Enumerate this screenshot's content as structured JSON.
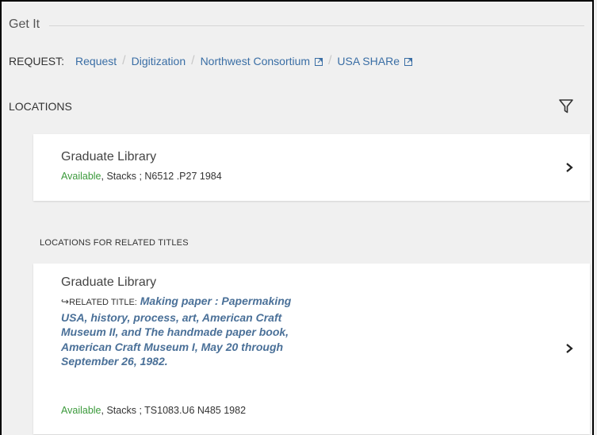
{
  "getit": {
    "title": "Get It"
  },
  "request": {
    "label": "REQUEST:",
    "options": [
      {
        "label": "Request"
      },
      {
        "label": "Digitization"
      },
      {
        "label": "Northwest Consortium"
      },
      {
        "label": "USA SHARe"
      }
    ],
    "separator": "/"
  },
  "locations": {
    "label": "LOCATIONS",
    "filter_icon": "filter-icon"
  },
  "holdings": [
    {
      "library": "Graduate Library",
      "status": "Available",
      "details": ", Stacks ; N6512 .P27 1984"
    }
  ],
  "related": {
    "heading": "LOCATIONS FOR RELATED TITLES",
    "items": [
      {
        "library": "Graduate Library",
        "arrow": "↪",
        "related_label": "RELATED TITLE:",
        "title": "Making paper : Papermaking USA, history, process, art, American Craft Museum II, and The handmade paper book, American Craft Museum I, May 20 through September 26, 1982.",
        "status": "Available",
        "details": ", Stacks ; TS1083.U6 N485 1982"
      }
    ]
  },
  "colors": {
    "link": "#3a6ea5",
    "available": "#3b9a3b",
    "related_title": "#4a7098"
  }
}
